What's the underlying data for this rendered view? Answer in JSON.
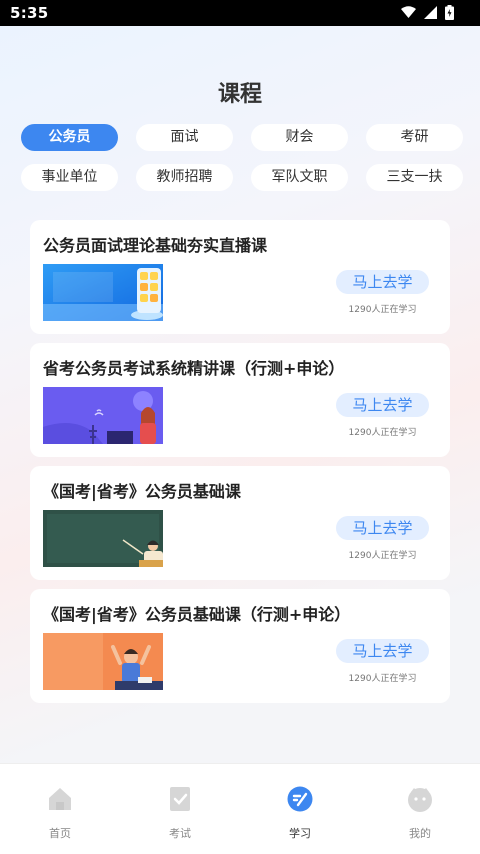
{
  "status_bar": {
    "time": "5:35"
  },
  "page": {
    "title": "课程"
  },
  "categories": [
    {
      "label": "公务员",
      "active": true
    },
    {
      "label": "面试"
    },
    {
      "label": "财会"
    },
    {
      "label": "考研"
    },
    {
      "label": "事业单位"
    },
    {
      "label": "教师招聘"
    },
    {
      "label": "军队文职"
    },
    {
      "label": "三支一扶"
    }
  ],
  "courses": [
    {
      "title": "公务员面试理论基础夯实直播课",
      "button": "马上去学",
      "learners": "1290人正在学习"
    },
    {
      "title": "省考公务员考试系统精讲课（行测+申论）",
      "button": "马上去学",
      "learners": "1290人正在学习"
    },
    {
      "title": "《国考|省考》公务员基础课",
      "button": "马上去学",
      "learners": "1290人正在学习"
    },
    {
      "title": "《国考|省考》公务员基础课（行测+申论）",
      "button": "马上去学",
      "learners": "1290人正在学习"
    }
  ],
  "tabbar": [
    {
      "label": "首页",
      "icon": "home-icon"
    },
    {
      "label": "考试",
      "icon": "exam-icon"
    },
    {
      "label": "学习",
      "icon": "study-icon",
      "active": true
    },
    {
      "label": "我的",
      "icon": "profile-icon"
    }
  ],
  "colors": {
    "accent": "#3d87f0",
    "accent_light": "#e3eeff",
    "inactive_icon": "#d6d6d6"
  }
}
